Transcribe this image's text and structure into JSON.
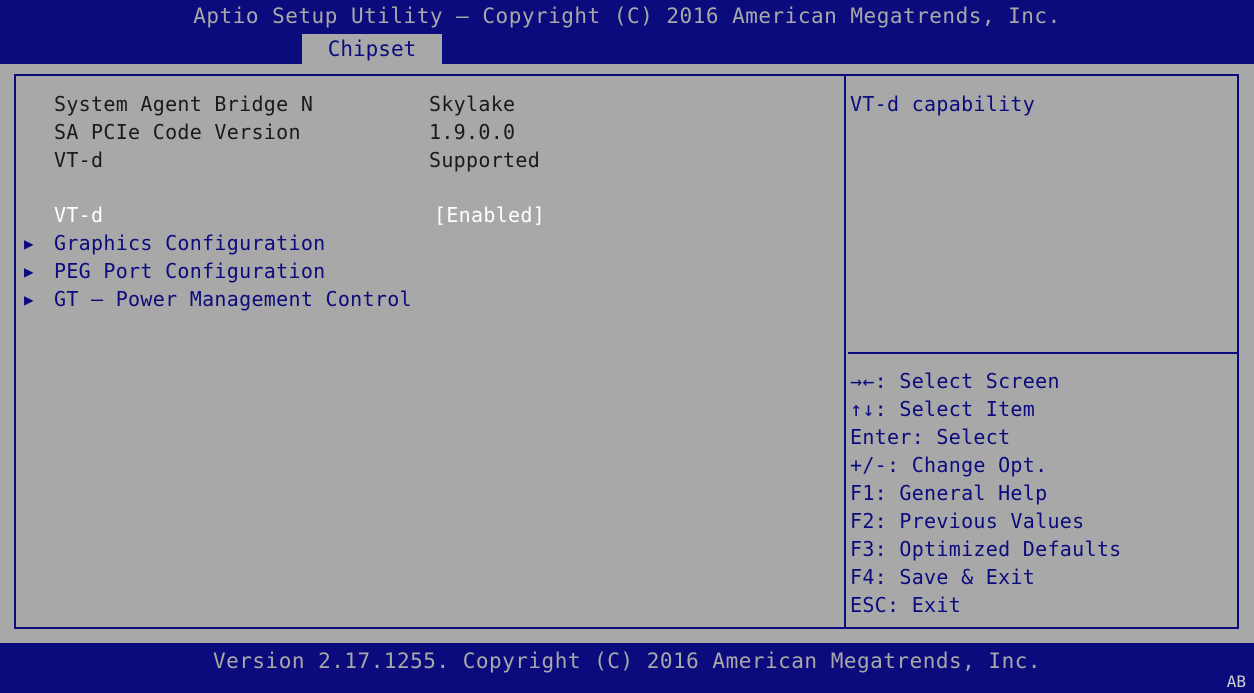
{
  "header": {
    "title": "Aptio Setup Utility – Copyright (C) 2016 American Megatrends, Inc.",
    "active_tab": "Chipset"
  },
  "info_rows": [
    {
      "label": "System Agent Bridge N",
      "value": "Skylake"
    },
    {
      "label": "SA PCIe Code Version",
      "value": "1.9.0.0"
    },
    {
      "label": "VT-d",
      "value": "Supported"
    }
  ],
  "selected_setting": {
    "label": "VT-d",
    "value": "[Enabled]"
  },
  "submenus": [
    {
      "label": "Graphics Configuration"
    },
    {
      "label": "PEG Port Configuration"
    },
    {
      "label": "GT – Power Management Control"
    }
  ],
  "help": {
    "description": "VT-d capability",
    "keys": [
      "→←: Select Screen",
      "↑↓: Select Item",
      "Enter: Select",
      "+/-: Change Opt.",
      "F1: General Help",
      "F2: Previous Values",
      "F3: Optimized Defaults",
      "F4: Save & Exit",
      "ESC: Exit"
    ]
  },
  "footer": {
    "text": "Version 2.17.1255. Copyright (C) 2016 American Megatrends, Inc.",
    "code": "AB"
  },
  "icons": {
    "submenu_arrow": "triangle-right-icon"
  },
  "colors": {
    "background": "#a8a8a8",
    "accent": "#0b0b7d",
    "highlight": "#ffffff"
  }
}
